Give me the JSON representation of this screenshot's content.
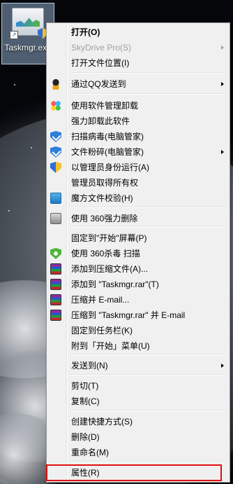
{
  "desktop": {
    "icon_label": "Taskmgr.exe"
  },
  "menu": {
    "items": [
      {
        "label": "打开(O)",
        "icon": null,
        "bold": true,
        "disabled": false,
        "submenu": false
      },
      {
        "label": "SkyDrive Pro(S)",
        "icon": null,
        "bold": false,
        "disabled": true,
        "submenu": true
      },
      {
        "label": "打开文件位置(I)",
        "icon": null,
        "bold": false,
        "disabled": false,
        "submenu": false
      },
      {
        "label": "通过QQ发送到",
        "icon": "qq-icon",
        "bold": false,
        "disabled": false,
        "submenu": true
      },
      {
        "label": "使用软件管理卸载",
        "icon": "software-manager-icon",
        "bold": false,
        "disabled": false,
        "submenu": false
      },
      {
        "label": "强力卸载此软件",
        "icon": null,
        "bold": false,
        "disabled": false,
        "submenu": false
      },
      {
        "label": "扫描病毒(电脑管家)",
        "icon": "pc-manager-icon",
        "bold": false,
        "disabled": false,
        "submenu": false
      },
      {
        "label": "文件粉碎(电脑管家)",
        "icon": "pc-manager-icon",
        "bold": false,
        "disabled": false,
        "submenu": true
      },
      {
        "label": "以管理员身份运行(A)",
        "icon": "uac-shield-icon",
        "bold": false,
        "disabled": false,
        "submenu": false
      },
      {
        "label": "管理员取得所有权",
        "icon": null,
        "bold": false,
        "disabled": false,
        "submenu": false
      },
      {
        "label": "魔方文件校验(H)",
        "icon": "mofang-icon",
        "bold": false,
        "disabled": false,
        "submenu": false
      },
      {
        "label": "使用 360强力删除",
        "icon": "360-delete-icon",
        "bold": false,
        "disabled": false,
        "submenu": false
      },
      {
        "label": "固定到\"开始\"屏幕(P)",
        "icon": null,
        "bold": false,
        "disabled": false,
        "submenu": false
      },
      {
        "label": "使用 360杀毒 扫描",
        "icon": "360-antivirus-icon",
        "bold": false,
        "disabled": false,
        "submenu": false
      },
      {
        "label": "添加到压缩文件(A)...",
        "icon": "winrar-icon",
        "bold": false,
        "disabled": false,
        "submenu": false
      },
      {
        "label": "添加到 \"Taskmgr.rar\"(T)",
        "icon": "winrar-icon",
        "bold": false,
        "disabled": false,
        "submenu": false
      },
      {
        "label": "压缩并 E-mail...",
        "icon": "winrar-icon",
        "bold": false,
        "disabled": false,
        "submenu": false
      },
      {
        "label": "压缩到 \"Taskmgr.rar\" 并 E-mail",
        "icon": "winrar-icon",
        "bold": false,
        "disabled": false,
        "submenu": false
      },
      {
        "label": "固定到任务栏(K)",
        "icon": null,
        "bold": false,
        "disabled": false,
        "submenu": false
      },
      {
        "label": "附到「开始」菜单(U)",
        "icon": null,
        "bold": false,
        "disabled": false,
        "submenu": false
      },
      {
        "label": "发送到(N)",
        "icon": null,
        "bold": false,
        "disabled": false,
        "submenu": true
      },
      {
        "label": "剪切(T)",
        "icon": null,
        "bold": false,
        "disabled": false,
        "submenu": false
      },
      {
        "label": "复制(C)",
        "icon": null,
        "bold": false,
        "disabled": false,
        "submenu": false
      },
      {
        "label": "创建快捷方式(S)",
        "icon": null,
        "bold": false,
        "disabled": false,
        "submenu": false
      },
      {
        "label": "删除(D)",
        "icon": null,
        "bold": false,
        "disabled": false,
        "submenu": false
      },
      {
        "label": "重命名(M)",
        "icon": null,
        "bold": false,
        "disabled": false,
        "submenu": false
      },
      {
        "label": "属性(R)",
        "icon": null,
        "bold": false,
        "disabled": false,
        "submenu": false
      }
    ]
  },
  "colors": {
    "menu_bg": "#f0f0f0",
    "highlight_box": "#e01010"
  }
}
